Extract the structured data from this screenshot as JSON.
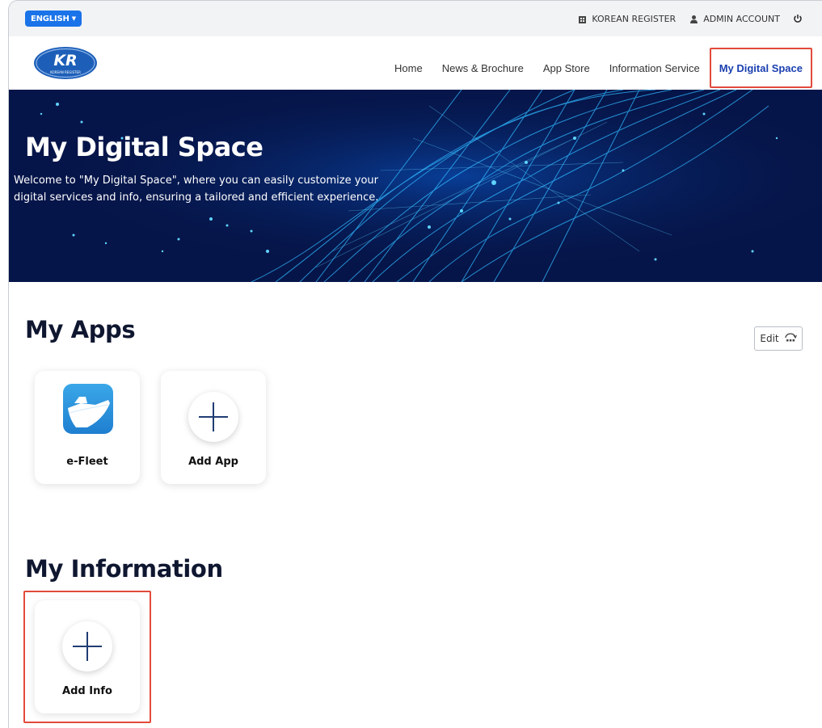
{
  "topbar": {
    "language": "ENGLISH",
    "org_link": "KOREAN REGISTER",
    "account_link": "ADMIN ACCOUNT"
  },
  "logo": {
    "text": "KR",
    "subtext": "KOREAN REGISTER"
  },
  "nav": {
    "items": [
      {
        "label": "Home"
      },
      {
        "label": "News & Brochure"
      },
      {
        "label": "App Store"
      },
      {
        "label": "Information Service"
      },
      {
        "label": "My Digital Space"
      }
    ],
    "active_index": 4
  },
  "hero": {
    "title": "My Digital Space",
    "description": "Welcome to \"My Digital Space\", where you can easily customize your digital services and info, ensuring a tailored and efficient experience."
  },
  "my_apps": {
    "title": "My Apps",
    "edit_label": "Edit",
    "apps": [
      {
        "label": "e-Fleet"
      },
      {
        "label": "Add App"
      }
    ]
  },
  "my_information": {
    "title": "My Information",
    "items": [
      {
        "label": "Add Info"
      }
    ]
  },
  "colors": {
    "accent": "#1a73e8",
    "active_nav": "#1a3fb0",
    "hero_bg": "#061549",
    "highlight": "#e24a3b"
  }
}
